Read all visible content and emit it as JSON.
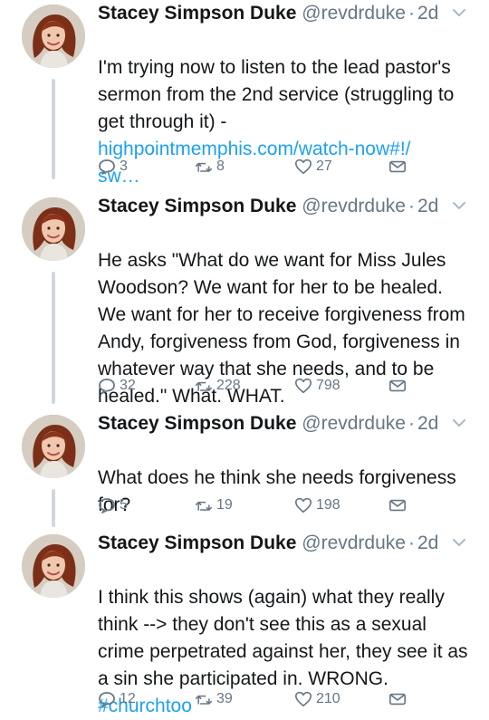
{
  "tweets": [
    {
      "name": "Stacey Simpson Duke",
      "handle": "@revdrduke",
      "dot": "·",
      "time": "2d",
      "text": "I'm trying now to listen to the lead pastor's sermon from the 2nd service (struggling to get through it) -",
      "link": "highpointmemphis.com/watch-now#!/\nsw…",
      "replies": "3",
      "retweets": "8",
      "likes": "27"
    },
    {
      "name": "Stacey Simpson Duke",
      "handle": "@revdrduke",
      "dot": "·",
      "time": "2d",
      "text": "He asks \"What do we want for Miss Jules Woodson? We want for her to be healed. We want for her to receive forgiveness from Andy, forgiveness from God, forgiveness in whatever way that she needs, and to be healed.\" What. WHAT.",
      "replies": "32",
      "retweets": "228",
      "likes": "798"
    },
    {
      "name": "Stacey Simpson Duke",
      "handle": "@revdrduke",
      "dot": "·",
      "time": "2d",
      "text": "What does he think she needs forgiveness for?",
      "replies": "5",
      "retweets": "19",
      "likes": "198"
    },
    {
      "name": "Stacey Simpson Duke",
      "handle": "@revdrduke",
      "dot": "·",
      "time": "2d",
      "text": "I think this shows (again) what they really think --> they don't see this as a sexual crime perpetrated against her, they see it as a sin she participated in. WRONG.",
      "hashtag": "#churchtoo",
      "replies": "12",
      "retweets": "39",
      "likes": "210"
    }
  ],
  "icons": {
    "reply": "reply-icon",
    "retweet": "retweet-icon",
    "like": "heart-icon",
    "dm": "envelope-icon",
    "menu": "chevron-down-icon"
  },
  "colors": {
    "text": "#14171a",
    "muted": "#657786",
    "link": "#1da1f2",
    "thread": "#cfd8de"
  }
}
